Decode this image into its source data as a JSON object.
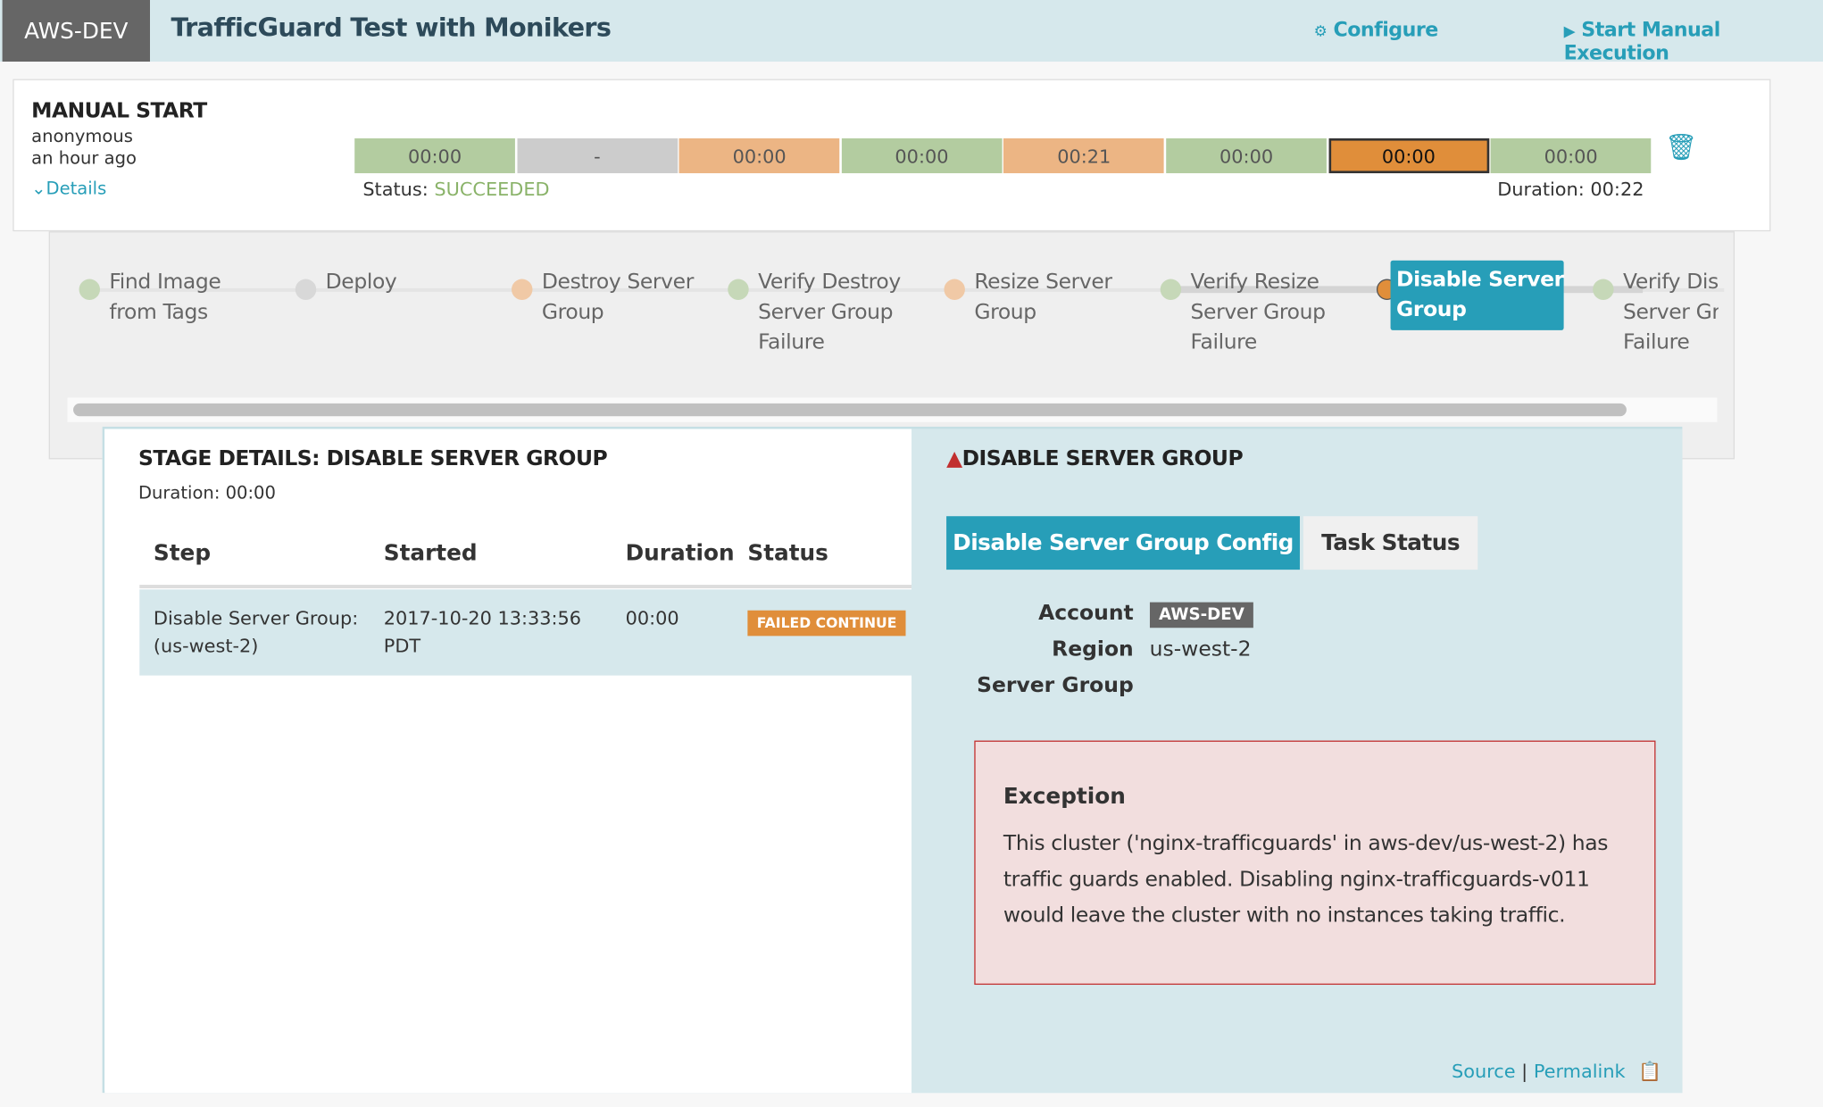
{
  "header": {
    "account": "AWS-DEV",
    "title": "TrafficGuard Test with Monikers",
    "configure": "Configure",
    "start": "Start Manual Execution"
  },
  "execution": {
    "trigger": "MANUAL START",
    "user": "anonymous",
    "time": "an hour ago",
    "details": "Details",
    "status_label": "Status:",
    "status": "SUCCEEDED",
    "duration": "Duration: 00:22",
    "segments": [
      {
        "t": "00:00",
        "s": "succeeded"
      },
      {
        "t": "-",
        "s": "skipped"
      },
      {
        "t": "00:00",
        "s": "warn"
      },
      {
        "t": "00:00",
        "s": "succeeded"
      },
      {
        "t": "00:21",
        "s": "warn"
      },
      {
        "t": "00:00",
        "s": "succeeded"
      },
      {
        "t": "00:00",
        "s": "active"
      },
      {
        "t": "00:00",
        "s": "succeeded"
      }
    ]
  },
  "colors": {
    "succeeded": "#b3cca0",
    "skipped": "#cccccc",
    "warn": "#ecb584",
    "active": "#e08e3a",
    "accent": "#279eb8",
    "error": "#c12f2f"
  },
  "graph": {
    "stages": [
      {
        "l1": "Find Image",
        "l2": "from Tags",
        "l3": "",
        "s": "succeeded"
      },
      {
        "l1": "Deploy",
        "l2": "",
        "l3": "",
        "s": "skipped"
      },
      {
        "l1": "Destroy Server",
        "l2": "Group",
        "l3": "",
        "s": "warn"
      },
      {
        "l1": "Verify Destroy",
        "l2": "Server Group",
        "l3": "Failure",
        "s": "succeeded"
      },
      {
        "l1": "Resize Server",
        "l2": "Group",
        "l3": "",
        "s": "warn"
      },
      {
        "l1": "Verify Resize",
        "l2": "Server Group",
        "l3": "Failure",
        "s": "succeeded"
      },
      {
        "l1": "Disable Server",
        "l2": "Group",
        "l3": "",
        "s": "active"
      },
      {
        "l1": "Verify Dis",
        "l2": "Server Gr",
        "l3": "Failure",
        "s": "succeeded"
      }
    ]
  },
  "stage": {
    "title": "STAGE DETAILS: DISABLE SERVER GROUP",
    "duration": "Duration: 00:00",
    "columns": [
      "Step",
      "Started",
      "Duration",
      "Status"
    ],
    "rows": [
      {
        "step1": "Disable Server Group:",
        "step2": "(us-west-2)",
        "started1": "2017-10-20 13:33:56",
        "started2": "PDT",
        "duration": "00:00",
        "status": "FAILED CONTINUE"
      }
    ]
  },
  "task": {
    "title": "DISABLE SERVER GROUP",
    "tabs": [
      "Disable Server Group Config",
      "Task Status"
    ],
    "account_label": "Account",
    "account": "AWS-DEV",
    "region_label": "Region",
    "region": "us-west-2",
    "sg_label": "Server Group",
    "exception_title": "Exception",
    "exception": "This cluster ('nginx-trafficguards' in aws-dev/us-west-2) has traffic guards enabled. Disabling nginx-trafficguards-v011 would leave the cluster with no instances taking traffic.",
    "source": "Source",
    "permalink": "Permalink"
  }
}
